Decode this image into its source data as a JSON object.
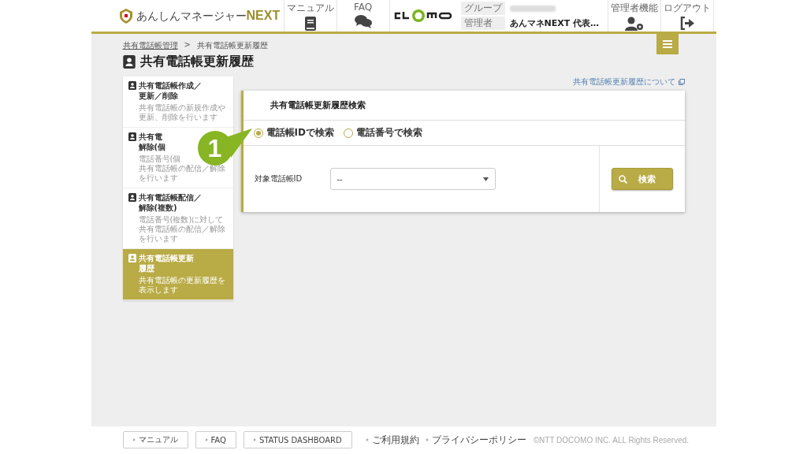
{
  "header": {
    "logo_text": "あんしんマネージャー",
    "logo_accent": "NEXT",
    "nav": [
      {
        "label": "マニュアル",
        "kind": "book"
      },
      {
        "label": "FAQ",
        "kind": "chat"
      }
    ],
    "group_label": "グループ",
    "admin_label": "管理者",
    "admin_name": "あんマネNEXT 代表…",
    "actions": [
      {
        "label": "管理者機能",
        "kind": "admin"
      },
      {
        "label": "ログアウト",
        "kind": "logout"
      }
    ]
  },
  "breadcrumb": [
    {
      "label": "共有電話帳管理",
      "link": true
    },
    {
      "label": "共有電話帳更新履歴",
      "link": false
    }
  ],
  "separator": ">",
  "page_title": "共有電話帳更新履歴",
  "help_link": "共有電話帳更新履歴について",
  "sidebar": [
    {
      "title_lines": [
        "共有電話帳作成／",
        "更新／削除"
      ],
      "desc_lines": [
        "共有電話帳の新規作成や",
        "更新、削除を行います"
      ],
      "selected": false
    },
    {
      "title_lines": [
        "共有電",
        "解除(個"
      ],
      "desc_lines": [
        "電話番号(個",
        "共有電話帳の配信／解除",
        "を行います"
      ],
      "selected": false
    },
    {
      "title_lines": [
        "共有電話帳配信／",
        "解除(複数)"
      ],
      "desc_lines": [
        "電話番号(複数)に対して",
        "共有電話帳の配信／解除",
        "を行います"
      ],
      "selected": false
    },
    {
      "title_lines": [
        "共有電話帳更新",
        "履歴"
      ],
      "desc_lines": [
        "共有電話帳の更新履歴を",
        "表示します"
      ],
      "selected": true
    }
  ],
  "panel": {
    "title": "共有電話帳更新履歴検索",
    "radios": [
      {
        "label": "電話帳IDで検索",
        "selected": true
      },
      {
        "label": "電話番号で検索",
        "selected": false
      }
    ],
    "field_label": "対象電話帳ID",
    "select_value": "--",
    "search_button": "検索"
  },
  "callout": "1",
  "footer": {
    "buttons": [
      "マニュアル",
      "FAQ",
      "STATUS DASHBOARD"
    ],
    "links": [
      "ご利用規約",
      "プライバシーポリシー"
    ],
    "copyright": "©NTT DOCOMO INC. ALL Rights Reserved."
  }
}
